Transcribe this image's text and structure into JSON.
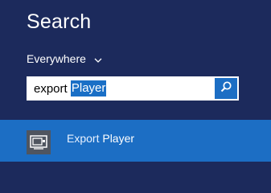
{
  "panel": {
    "title": "Search",
    "scope_label": "Everywhere"
  },
  "search": {
    "typed": "export ",
    "selected": "Player",
    "button_icon": "search-icon"
  },
  "results": [
    {
      "app_name_prefix": "Export ",
      "app_name_match": "Player",
      "icon": "player-app-icon"
    }
  ],
  "colors": {
    "background": "#1c2a5c",
    "accent": "#1c6ec4",
    "tile": "#4f5560"
  }
}
